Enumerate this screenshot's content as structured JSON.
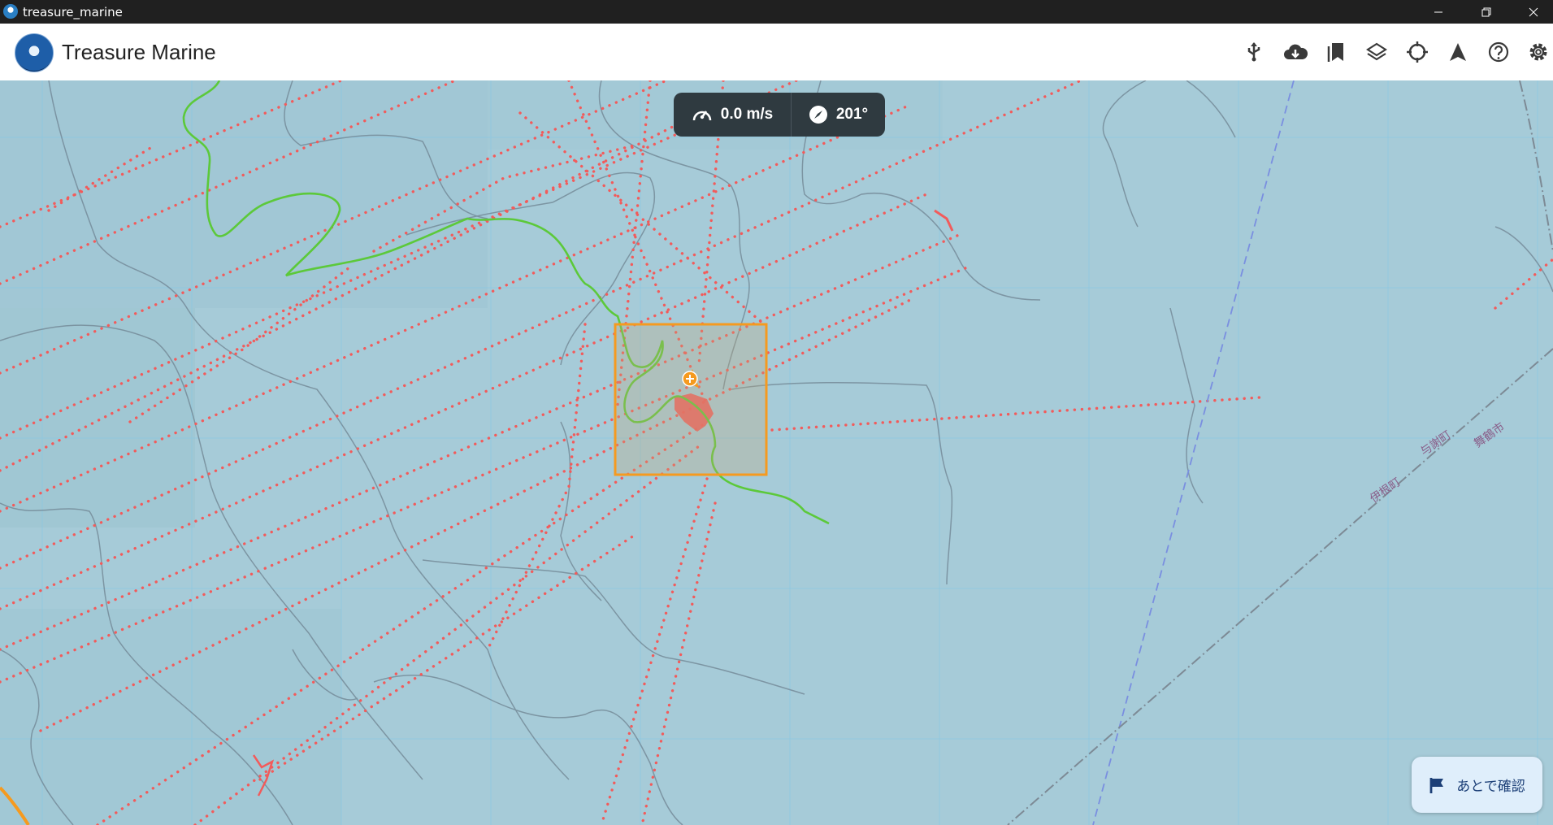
{
  "window": {
    "title": "treasure_marine"
  },
  "app": {
    "name": "Treasure Marine"
  },
  "toolbar": {
    "icons": [
      "usb-icon",
      "cloud-download-icon",
      "bookmarks-icon",
      "layers-icon",
      "crosshair-icon",
      "navigation-arrow-icon",
      "help-icon",
      "settings-gear-icon"
    ]
  },
  "status": {
    "speed": "0.0 m/s",
    "heading": "201°"
  },
  "map": {
    "labels": [
      "伊根町",
      "与謝町",
      "舞鶴市"
    ],
    "colors": {
      "water": "#a6cbd8",
      "track_dots": "#f25b5b",
      "route": "#5cc93a",
      "selection": "#f59a1f",
      "boundary": "#6b7f8f"
    }
  },
  "actions": {
    "later_label": "あとで確認"
  }
}
